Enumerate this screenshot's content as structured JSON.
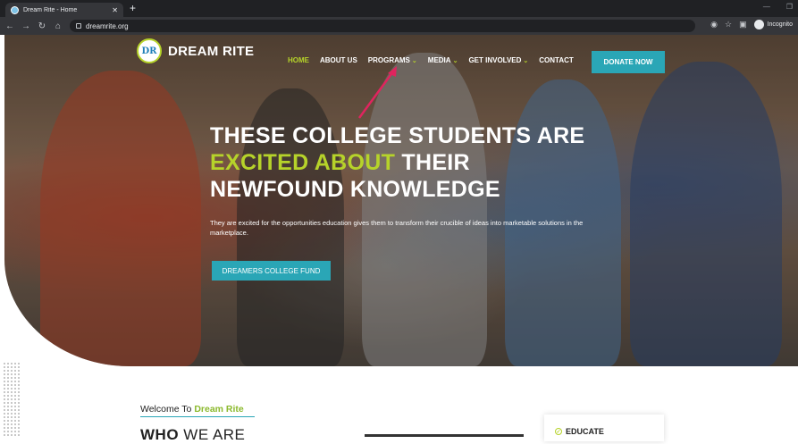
{
  "browser": {
    "tab_title": "Dream Rite - Home",
    "url": "dreamrite.org",
    "incognito_label": "Incognito",
    "nav_icons": [
      "back-icon",
      "forward-icon",
      "reload-icon",
      "home-icon"
    ]
  },
  "site": {
    "brand_name": "DREAM RITE",
    "logo_text": "DR",
    "menu": [
      {
        "label": "HOME",
        "active": true,
        "has_dropdown": false
      },
      {
        "label": "ABOUT US",
        "active": false,
        "has_dropdown": false
      },
      {
        "label": "PROGRAMS",
        "active": false,
        "has_dropdown": true
      },
      {
        "label": "MEDIA",
        "active": false,
        "has_dropdown": true
      },
      {
        "label": "GET INVOLVED",
        "active": false,
        "has_dropdown": true
      },
      {
        "label": "CONTACT",
        "active": false,
        "has_dropdown": false
      }
    ],
    "donate_label": "DONATE NOW"
  },
  "hero": {
    "headline_line1": "THESE COLLEGE STUDENTS ARE",
    "headline_line2_highlight": "EXCITED ABOUT",
    "headline_line2_rest": " THEIR",
    "headline_line3": "NEWFOUND KNOWLEDGE",
    "subtext": "They are excited for the opportunities education gives them to transform their crucible of ideas into marketable solutions in the marketplace.",
    "cta_label": "DREAMERS COLLEGE FUND"
  },
  "about": {
    "welcome_prefix": "Welcome To ",
    "welcome_highlight": "Dream Rite",
    "heading_bold": "WHO",
    "heading_rest": " WE ARE",
    "card_title": "EDUCATE"
  },
  "colors": {
    "accent_green": "#b6d32a",
    "accent_teal": "#2aa6b6",
    "annotation_arrow": "#e0245e"
  }
}
